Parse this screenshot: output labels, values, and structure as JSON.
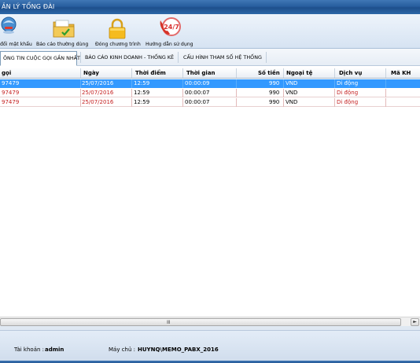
{
  "window": {
    "title": "ẢN LÝ TỔNG ĐÀI"
  },
  "toolbar": {
    "items": [
      {
        "label": "đổi mật khẩu",
        "icon": "change-password-icon"
      },
      {
        "label": "Báo cáo thường dùng",
        "icon": "folder-report-icon"
      },
      {
        "label": "Đóng chương trình",
        "icon": "lock-icon"
      },
      {
        "label": "Hướng dẫn sử dụng",
        "icon": "support-24-7-icon"
      }
    ]
  },
  "tabs": [
    {
      "label": "ÔNG TIN CUỘC GỌI GẦN NHẤT",
      "active": true
    },
    {
      "label": "BÁO CÁO KINH DOANH - THỐNG KÊ",
      "active": false
    },
    {
      "label": "CẤU HÌNH THAM SỐ HỆ THỐNG",
      "active": false
    }
  ],
  "grid": {
    "columns": [
      "gọi",
      "Ngày",
      "Thời điểm",
      "Thời gian",
      "Số tiền",
      "Ngoại tệ",
      "Dịch vụ",
      "Mã KH"
    ],
    "rows": [
      {
        "caller": "97479",
        "date": "25/07/2016",
        "time": "12:59",
        "duration": "00:00:09",
        "amount": "990",
        "currency": "VND",
        "service": "Di động",
        "customer": "",
        "selected": true
      },
      {
        "caller": "97479",
        "date": "25/07/2016",
        "time": "12:59",
        "duration": "00:00:07",
        "amount": "990",
        "currency": "VND",
        "service": "Di động",
        "customer": "",
        "selected": false
      },
      {
        "caller": "97479",
        "date": "25/07/2016",
        "time": "12:59",
        "duration": "00:00:07",
        "amount": "990",
        "currency": "VND",
        "service": "Di động",
        "customer": "",
        "selected": false
      }
    ],
    "scroll_grip": "III"
  },
  "status": {
    "account_label": "Tài khoản :",
    "account_value": "admin",
    "server_label": "Máy chủ :",
    "server_value": "HUYNQ\\MEMO_PABX_2016"
  },
  "colors": {
    "selection": "#3399ff",
    "title_bar": "#275e9e",
    "cell_text": "#c41e1e"
  }
}
